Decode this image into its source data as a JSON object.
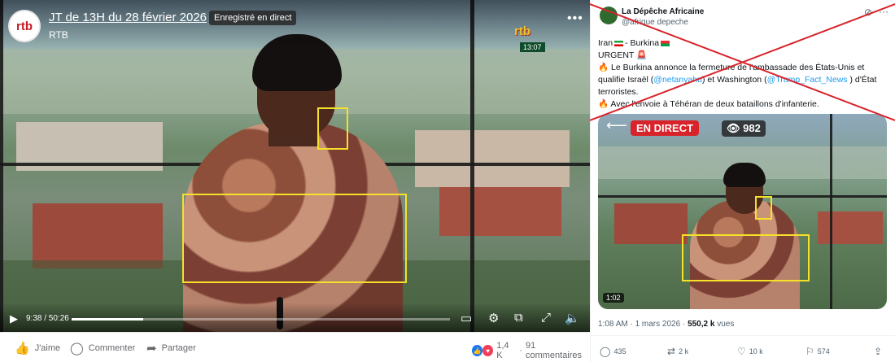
{
  "facebook": {
    "logo_text": "rtb",
    "title": "JT de 13H du 28 février 2026",
    "badge": "Enregistré en direct",
    "channel": "RTB",
    "watermark": "rtb",
    "clock": "13:07",
    "more_icon": "more-dots-icon",
    "time_display": "9:38 / 50:26",
    "progress_fraction": 0.19,
    "actions": {
      "like": "J'aime",
      "comment": "Commenter",
      "share": "Partager"
    },
    "reaction_count": "1,4 K",
    "comment_count": "91 commentaires"
  },
  "x_post": {
    "account_name": "La Dépêche Africaine",
    "handle": "@afrique depeche",
    "lines": {
      "l1": "Iran",
      "l1b": "- Burkina",
      "l2": "URGENT",
      "l3a": "Le Burkina annonce la fermeture de l'ambassade des États-Unis et",
      "l4a": "qualifie Israël (",
      "l4_mention": "@netanyahu",
      "l4b": ") et Washington (",
      "l4_mention2": "@Trump_Fact_News",
      "l4c": " ) d'État",
      "l5": "terroristes.",
      "l6": "Avec l'envoie à Téhéran de deux bataillons d'infanterie."
    },
    "live_label": "EN DIRECT",
    "viewers": "982",
    "duration": "1:02",
    "timestamp": "1:08 AM · 1 mars 2026 · ",
    "views_count": "550,2 k",
    "views_label": " vues",
    "replies": "435",
    "reposts": "2 k",
    "likes": "10 k",
    "bookmarks": "574"
  },
  "colors": {
    "highlight_box": "#f5e12a",
    "cross_out": "#d8232a",
    "live_red": "#d8232a",
    "link_blue": "#1d9bf0"
  }
}
